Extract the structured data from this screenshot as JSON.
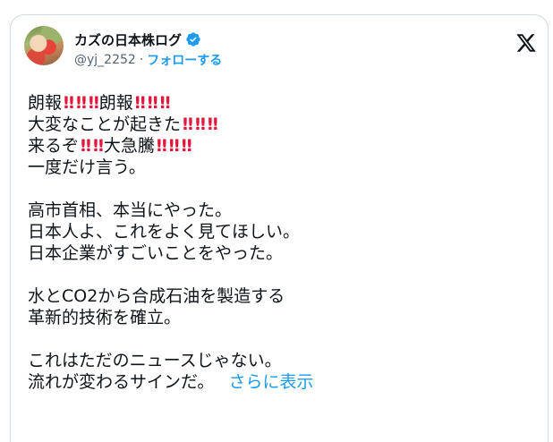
{
  "author": {
    "display_name": "カズの日本株ログ",
    "handle": "@yj_2252",
    "separator": "·",
    "follow_label": "フォローする"
  },
  "tweet": {
    "lines": [
      [
        "朗報",
        "‼",
        "‼",
        "‼",
        "朗報",
        "‼",
        "‼",
        "‼"
      ],
      [
        "大変なことが起きた",
        "‼",
        "‼",
        "‼"
      ],
      [
        "来るぞ",
        "‼",
        "‼",
        "大急騰",
        "‼",
        "‼",
        "‼"
      ],
      [
        "一度だけ言う。"
      ],
      [],
      [
        "高市首相、本当にやった。"
      ],
      [
        "日本人よ、これをよく見てほしい。"
      ],
      [
        "日本企業がすごいことをやった。"
      ],
      [],
      [
        "水とCO2から合成石油を製造する"
      ],
      [
        "革新的技術を確立。"
      ],
      [],
      [
        "これはただのニュースじゃない。"
      ],
      [
        "流れが変わるサインだ。"
      ]
    ],
    "show_more_label": "さらに表示"
  },
  "colors": {
    "accent": "#1d9bf0",
    "text": "#0f1419",
    "secondary": "#536471",
    "emoji_red": "#e3163b",
    "border": "#cfd9de"
  },
  "icons": {
    "verified": "verified-badge-icon",
    "logo": "x-logo-icon",
    "emphasis": "double-exclamation-emoji"
  }
}
